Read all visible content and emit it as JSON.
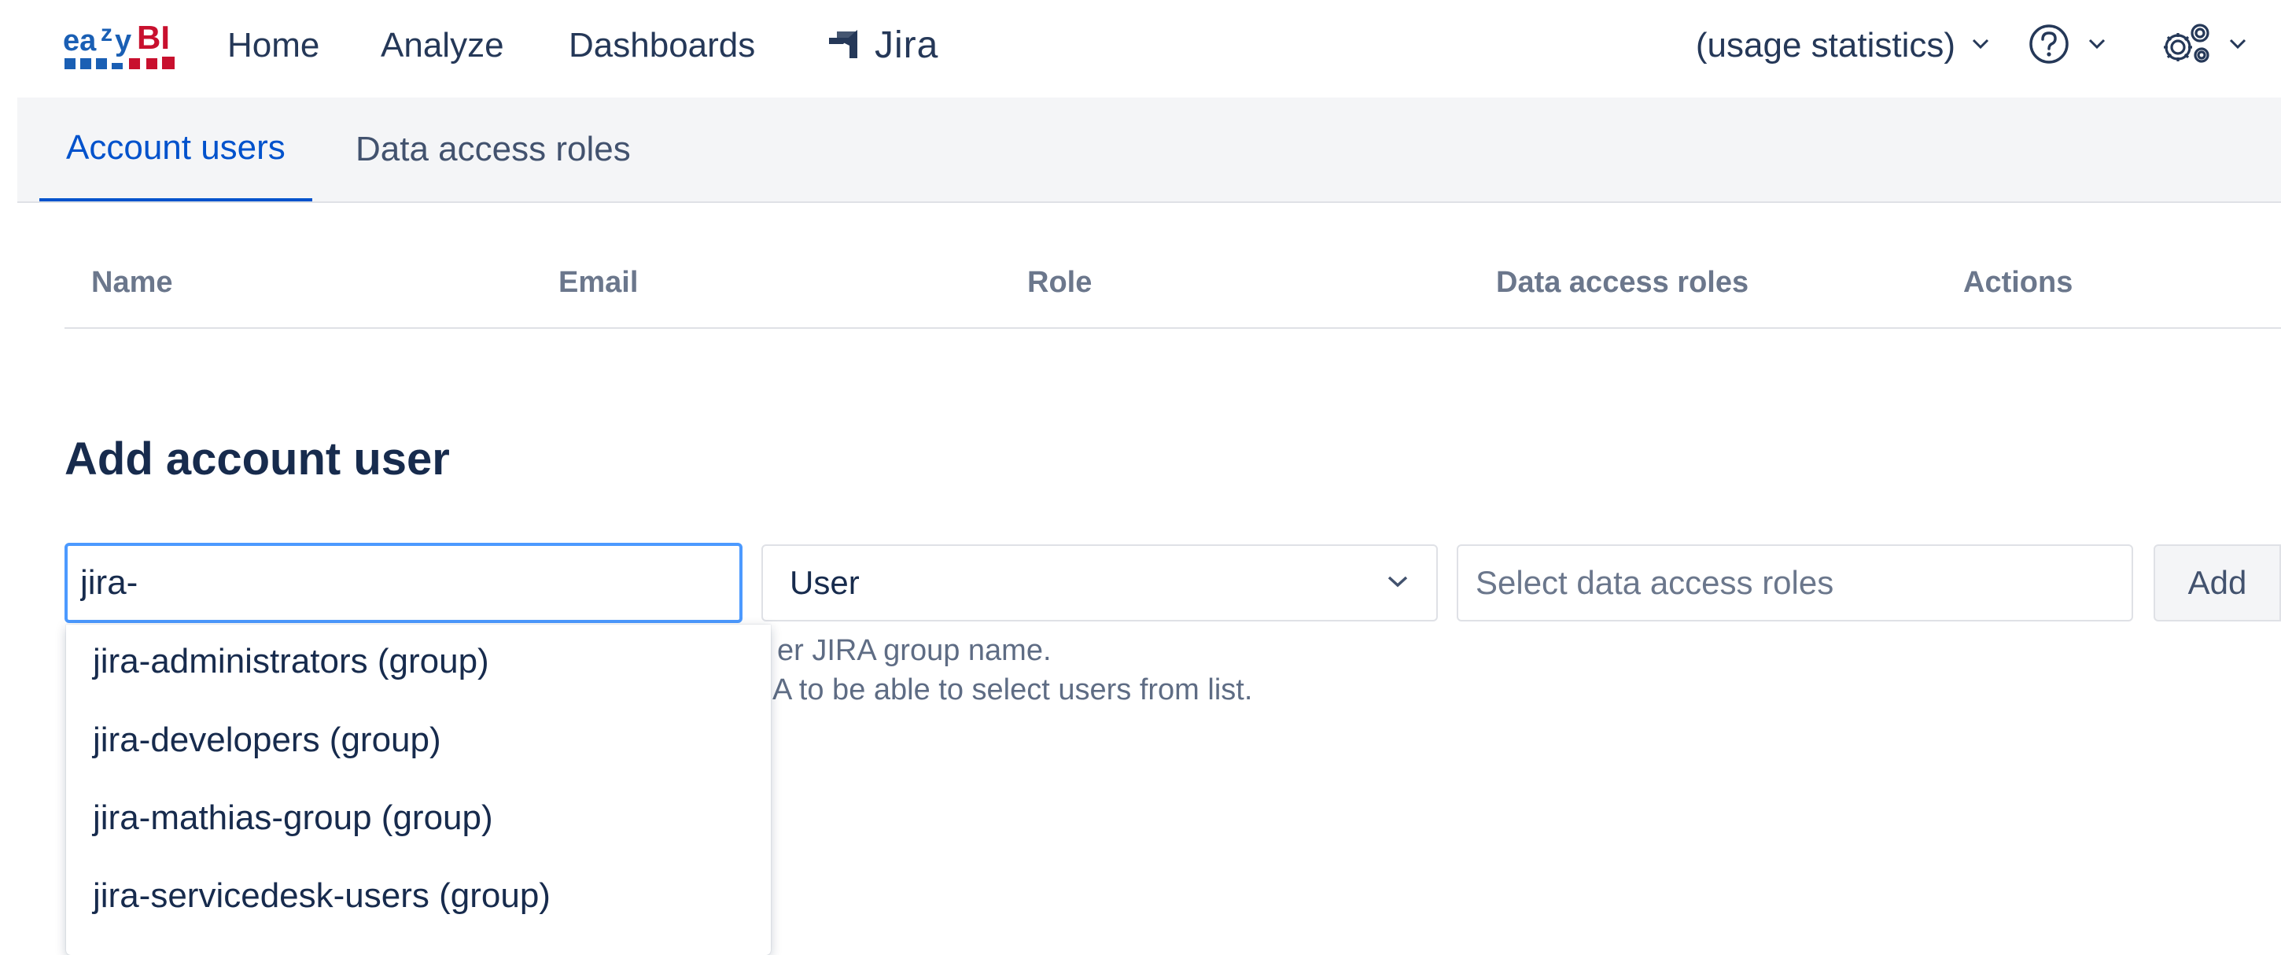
{
  "brand": {
    "logo_text": "eazyBI"
  },
  "nav": {
    "home": "Home",
    "analyze": "Analyze",
    "dashboards": "Dashboards",
    "jira": "Jira",
    "account": "(usage statistics)"
  },
  "tabs": [
    {
      "label": "Account users",
      "active": true
    },
    {
      "label": "Data access roles",
      "active": false
    }
  ],
  "table": {
    "columns": [
      "Name",
      "Email",
      "Role",
      "Data access roles",
      "Actions"
    ],
    "rows": []
  },
  "add_user": {
    "title": "Add account user",
    "user_input_value": "jira-",
    "role_select_value": "User",
    "access_roles_placeholder": "Select data access roles",
    "add_button": "Add",
    "help_line_1": "er JIRA group name.",
    "help_line_2": "A to be able to select users from list."
  },
  "autocomplete": [
    "jira-administrators (group)",
    "jira-developers (group)",
    "jira-mathias-group (group)",
    "jira-servicedesk-users (group)"
  ],
  "colors": {
    "accent": "#0052cc",
    "focus": "#4c9aff",
    "logo_blue": "#1a5fb4",
    "logo_red": "#c8102e"
  }
}
